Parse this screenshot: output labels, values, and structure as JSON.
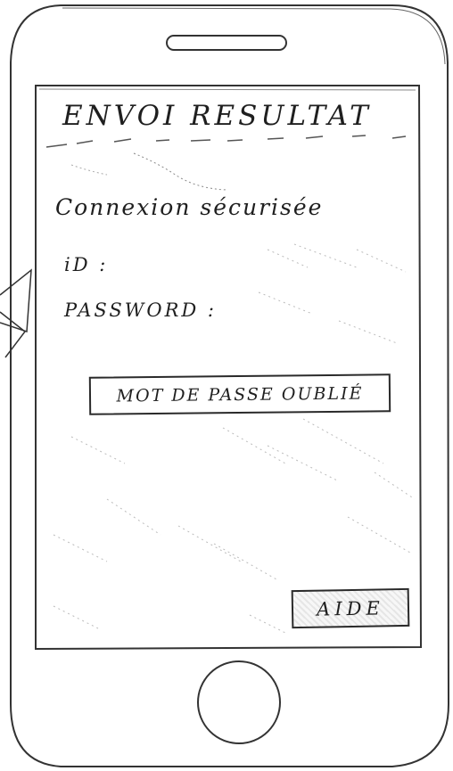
{
  "screen": {
    "title": "ENVOI RESULTAT",
    "subtitle": "Connexion sécurisée",
    "fields": {
      "id_label": "iD :",
      "password_label": "PASSWORD :"
    },
    "buttons": {
      "forgot_password": "MOT DE PASSE OUBLIÉ",
      "help": "AIDE"
    }
  },
  "icons": {
    "speaker": "speaker-slot-icon",
    "home": "home-button-icon",
    "side": "side-volume-button-icon"
  }
}
